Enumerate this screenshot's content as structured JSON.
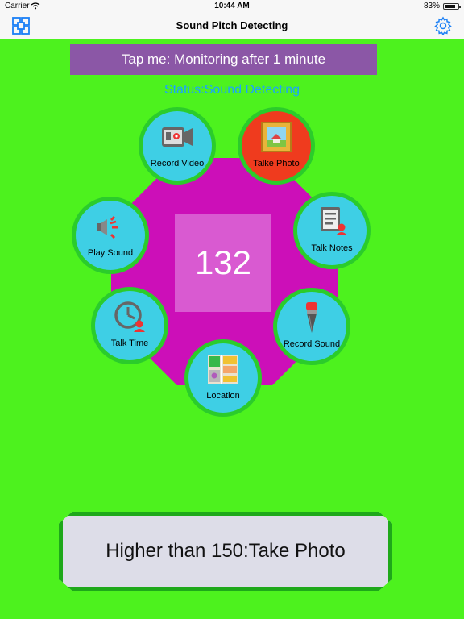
{
  "status_bar": {
    "carrier": "Carrier",
    "time": "10:44 AM",
    "battery": "83%",
    "battery_level": 0.83
  },
  "nav": {
    "title": "Sound Pitch Detecting",
    "left_icon": "grid-icon",
    "right_icon": "gear-icon"
  },
  "monitor": {
    "label": "Tap me: Monitoring after 1 minute"
  },
  "status": {
    "text": "Status:Sound Detecting"
  },
  "counter": {
    "value": "132"
  },
  "actions": [
    {
      "label": "Record Video",
      "icon": "video-camera-icon"
    },
    {
      "label": "Talke Photo",
      "icon": "photo-frame-icon"
    },
    {
      "label": "Talk Notes",
      "icon": "notes-icon"
    },
    {
      "label": "Record Sound",
      "icon": "microphone-icon"
    },
    {
      "label": "Location",
      "icon": "map-icon"
    },
    {
      "label": "Talk Time",
      "icon": "clock-icon"
    },
    {
      "label": "Play Sound",
      "icon": "speaker-icon"
    }
  ],
  "rule": {
    "label": "Higher than 150:Take Photo"
  },
  "colors": {
    "background": "#4df21e",
    "octagon": "#cc0fb8",
    "counter_box": "#d95ad1",
    "monitor_button": "#8b57a6",
    "status_text": "#1ba3ff",
    "circle": "#3ecfe5",
    "circle_ring": "#2bcc2b",
    "photo_circle": "#ef3b1e",
    "rule_border": "#1ea81a"
  }
}
